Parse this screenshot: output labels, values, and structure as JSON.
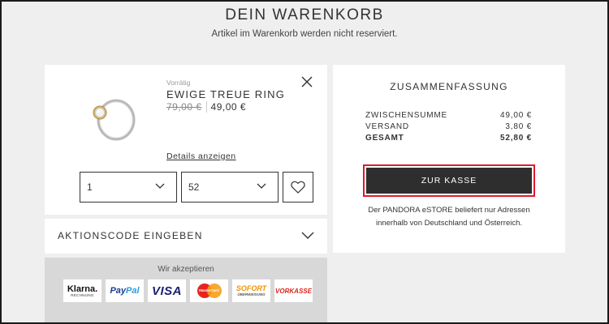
{
  "header": {
    "title": "DEIN WARENKORB",
    "subtitle": "Artikel im Warenkorb werden nicht reserviert."
  },
  "product": {
    "stock_status": "Vorrätig",
    "name": "EWIGE TREUE RING",
    "price_old": "79,00 €",
    "price_new": "49,00 €",
    "details_link": "Details anzeigen",
    "quantity": "1",
    "size": "52",
    "icons": {
      "close": "close-icon",
      "wishlist": "heart-icon",
      "dropdown": "chevron-down-icon"
    }
  },
  "promo": {
    "label": "AKTIONSCODE EINGEBEN"
  },
  "payment": {
    "title": "Wir akzeptieren",
    "methods": {
      "klarna": "Klarna.",
      "klarna_sub": "RECHNUNG",
      "paypal_pay": "Pay",
      "paypal_pal": "Pal",
      "visa": "VISA",
      "mastercard": "MasterCard",
      "sofort": "SOFORT",
      "sofort_sub": "ÜBERWEISUNG",
      "vorkasse": "VORKASSE"
    }
  },
  "summary": {
    "title": "ZUSAMMENFASSUNG",
    "subtotal_label": "ZWISCHENSUMME",
    "subtotal_value": "49,00 €",
    "shipping_label": "VERSAND",
    "shipping_value": "3,80 €",
    "total_label": "GESAMT",
    "total_value": "52,80 €",
    "checkout_label": "ZUR KASSE",
    "delivery_note": "Der PANDORA eSTORE beliefert nur Adressen innerhalb von Deutschland und Österreich."
  },
  "colors": {
    "background": "#efefef",
    "checkout_button": "#2e2e2e",
    "highlight_outline": "#e01a2b"
  }
}
